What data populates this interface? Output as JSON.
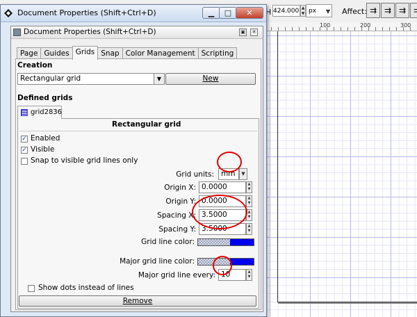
{
  "background": {
    "h_label": "H",
    "h_value": "424.000",
    "units": "px",
    "affect_label": "Affect:",
    "ruler_labels": [
      "100",
      "200",
      "300"
    ]
  },
  "outer_window": {
    "title": "Document Properties (Shift+Ctrl+D)",
    "min_glyph": "▁",
    "max_glyph": "□",
    "close_glyph": "✕"
  },
  "dialog": {
    "title": "Document Properties (Shift+Ctrl+D)",
    "tabs": [
      "Page",
      "Guides",
      "Grids",
      "Snap",
      "Color Management",
      "Scripting"
    ],
    "active_tab": "Grids",
    "creation_title": "Creation",
    "grid_type": "Rectangular grid",
    "new_button": "New",
    "defined_title": "Defined grids",
    "grid_tab_label": "grid2836",
    "grid_heading": "Rectangular grid",
    "enabled_label": "Enabled",
    "visible_label": "Visible",
    "snap_label": "Snap to visible grid lines only",
    "grid_units_label": "Grid units:",
    "grid_units_value": "mm",
    "origin_x_label": "Origin X:",
    "origin_x_value": "0.0000",
    "origin_y_label": "Origin Y:",
    "origin_y_value": "0.0000",
    "spacing_x_label": "Spacing X:",
    "spacing_x_value": "3.5000",
    "spacing_y_label": "Spacing Y:",
    "spacing_y_value": "3.5000",
    "grid_line_color_label": "Grid line color:",
    "grid_line_color": "#0000ee",
    "major_grid_line_color_label": "Major grid line color:",
    "major_grid_line_color": "#0000ee",
    "major_every_label": "Major grid line every:",
    "major_every_value": "10",
    "show_dots_label": "Show dots instead of lines",
    "remove_button": "Remove",
    "enabled_checked": true,
    "visible_checked": true,
    "snap_checked": false,
    "show_dots_checked": false
  },
  "colors": {
    "highlight_circle": "#e00000",
    "title_bar": "#cddcf0"
  }
}
